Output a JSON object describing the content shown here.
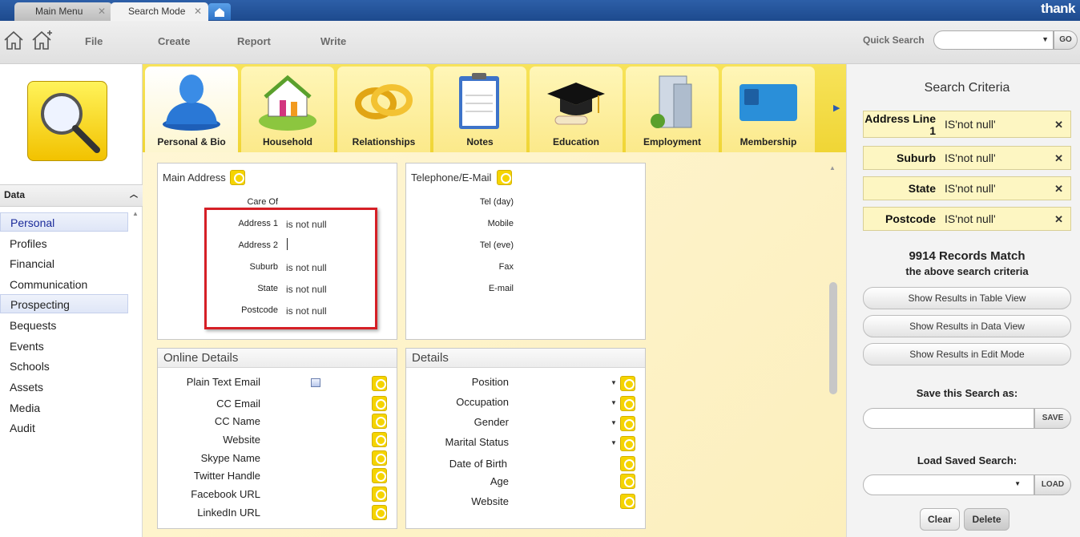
{
  "tabs": [
    {
      "label": "Main Menu"
    },
    {
      "label": "Search Mode"
    }
  ],
  "brand": "thank",
  "menu": {
    "file": "File",
    "create": "Create",
    "report": "Report",
    "write": "Write"
  },
  "quick_search": {
    "label": "Quick Search",
    "value": "",
    "go": "GO"
  },
  "sidebar": {
    "header": "Data",
    "items": [
      "Personal",
      "Profiles",
      "Financial",
      "Communication",
      "Prospecting",
      "Bequests",
      "Events",
      "Schools",
      "Assets",
      "Media",
      "Audit"
    ]
  },
  "categories": [
    "Personal & Bio",
    "Household",
    "Relationships",
    "Notes",
    "Education",
    "Employment",
    "Membership"
  ],
  "main_address": {
    "title": "Main Address",
    "fields": [
      {
        "label": "Care Of",
        "value": ""
      },
      {
        "label": "Address 1",
        "value": "is not null"
      },
      {
        "label": "Address 2",
        "value": ""
      },
      {
        "label": "Suburb",
        "value": "is not null"
      },
      {
        "label": "State",
        "value": "is not null"
      },
      {
        "label": "Postcode",
        "value": "is not null"
      }
    ]
  },
  "telephone": {
    "title": "Telephone/E-Mail",
    "fields": [
      "Tel (day)",
      "Mobile",
      "Tel (eve)",
      "Fax",
      "E-mail"
    ]
  },
  "online": {
    "title": "Online Details",
    "fields": [
      "Plain Text Email",
      "CC Email",
      "CC Name",
      "Website",
      "Skype Name",
      "Twitter Handle",
      "Facebook URL",
      "LinkedIn URL"
    ]
  },
  "details": {
    "title": "Details",
    "fields": [
      "Position",
      "Occupation",
      "Gender",
      "Marital Status",
      "Date of Birth",
      "Age",
      "Website"
    ]
  },
  "right": {
    "title": "Search Criteria",
    "criteria": [
      {
        "field_line1": "Address Line",
        "field_line2": "1",
        "value": "IS'not null'"
      },
      {
        "field": "Suburb",
        "value": "IS'not null'"
      },
      {
        "field": "State",
        "value": "IS'not null'"
      },
      {
        "field": "Postcode",
        "value": "IS'not null'"
      }
    ],
    "match_count": "9914 Records Match",
    "match_sub": "the above search criteria",
    "buttons": [
      "Show Results in Table View",
      "Show Results in Data View",
      "Show Results in Edit Mode"
    ],
    "save_label": "Save this Search as:",
    "save_btn": "SAVE",
    "load_label": "Load Saved Search:",
    "load_btn": "LOAD",
    "clear": "Clear",
    "delete": "Delete"
  },
  "colors": {
    "accent_blue": "#1d4a8e",
    "tile_yellow": "#f5d400",
    "highlight_red": "#d61f26",
    "criteria_bg": "#fdf6c2"
  }
}
